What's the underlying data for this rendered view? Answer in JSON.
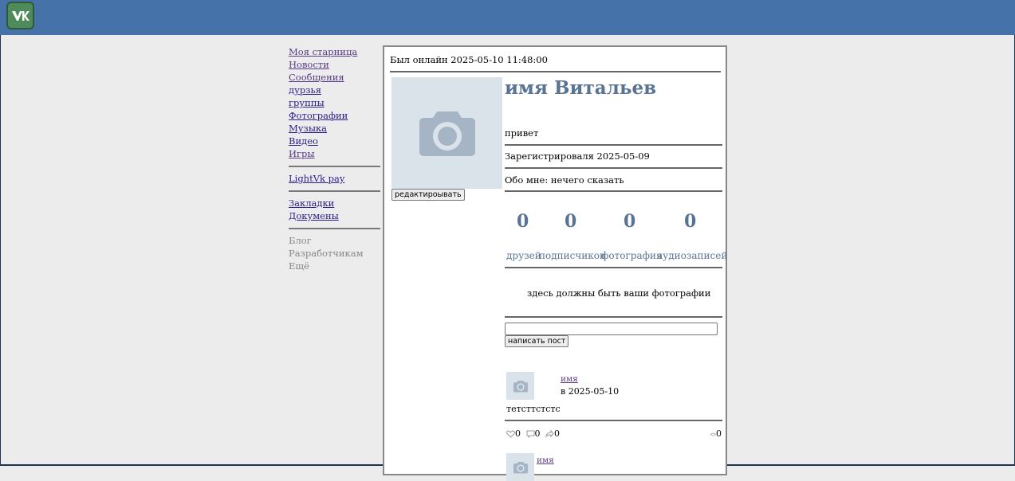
{
  "nav": {
    "items": [
      "Моя старница",
      "Новости",
      "Сообщения",
      "дурзья",
      "группы",
      "Фотографии",
      "Музыка",
      "Видео",
      "Игры"
    ],
    "pay": "LightVk pay",
    "bookmarks": "Закладки",
    "documents": "Докумены",
    "blog": "Блог Разработчикам",
    "more": "Ещё"
  },
  "profile": {
    "last_online": "Был онлайн 2025-05-10 11:48:00",
    "name": "имя Витальев",
    "status": "привет",
    "registered": "Зарегистрироваля 2025-05-09",
    "about": "Обо мне: нечего сказать",
    "edit_button": "редактироывать"
  },
  "stats": [
    {
      "value": "0",
      "label": "друзей"
    },
    {
      "value": "0",
      "label": "подписчиков"
    },
    {
      "value": "0",
      "label": "фотография"
    },
    {
      "value": "0",
      "label": "аудиозаписей"
    }
  ],
  "photos_empty": "здесь должны быть ваши фотографии",
  "composer": {
    "submit_label": "написать пост",
    "value": ""
  },
  "posts": [
    {
      "author": "имя",
      "date": "в 2025-05-10",
      "text": "тетсттстстс",
      "likes": "0",
      "comments": "0",
      "reposts": "0",
      "views": "0"
    },
    {
      "author": "имя"
    }
  ],
  "colors": {
    "header": "#4572a8",
    "accent": "#587394",
    "background": "#ececec"
  },
  "icons": [
    "vk-logo-icon",
    "camera-icon",
    "heart-icon",
    "comment-icon",
    "repost-icon",
    "eye-icon"
  ]
}
